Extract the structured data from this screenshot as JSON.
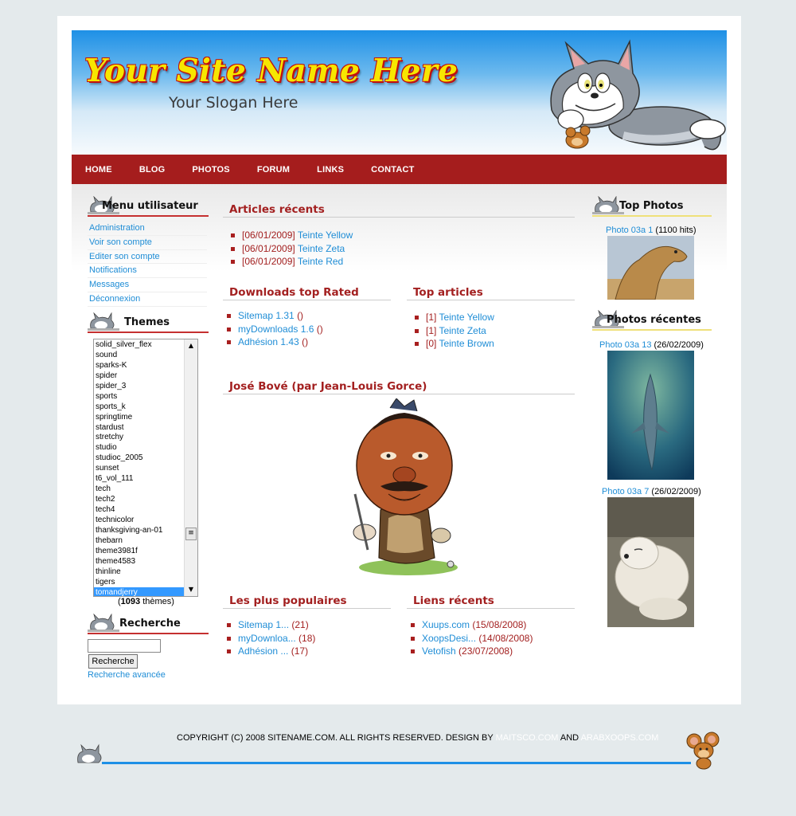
{
  "header": {
    "site_name": "Your Site Name Here",
    "slogan": "Your Slogan Here"
  },
  "nav": [
    "HOME",
    "BLOG",
    "PHOTOS",
    "FORUM",
    "LINKS",
    "CONTACT"
  ],
  "user_menu": {
    "title": "Menu utilisateur",
    "items": [
      "Administration",
      "Voir son compte",
      "Editer son compte",
      "Notifications",
      "Messages",
      "Déconnexion"
    ]
  },
  "themes": {
    "title": "Themes",
    "options": [
      "solid_silver_flex",
      "sound",
      "sparks-K",
      "spider",
      "spider_3",
      "sports",
      "sports_k",
      "springtime",
      "stardust",
      "stretchy",
      "studio",
      "studioc_2005",
      "sunset",
      "t6_vol_111",
      "tech",
      "tech2",
      "tech4",
      "technicolor",
      "thanksgiving-an-01",
      "thebarn",
      "theme3981f",
      "theme4583",
      "thinline",
      "tigers",
      "tomandjerry"
    ],
    "selected": "tomandjerry",
    "count": "1093",
    "count_suffix": "thèmes"
  },
  "search": {
    "title": "Recherche",
    "button": "Recherche",
    "advanced": "Recherche avancée",
    "value": ""
  },
  "recent_articles": {
    "title": "Articles récents",
    "items": [
      {
        "date": "[06/01/2009]",
        "link": "Teinte Yellow"
      },
      {
        "date": "[06/01/2009]",
        "link": "Teinte Zeta"
      },
      {
        "date": "[06/01/2009]",
        "link": "Teinte Red"
      }
    ]
  },
  "downloads_top": {
    "title": "Downloads top Rated",
    "items": [
      {
        "link": "Sitemap 1.31",
        "extra": "()"
      },
      {
        "link": "myDownloads 1.6",
        "extra": "()"
      },
      {
        "link": "Adhésion 1.43",
        "extra": "()"
      }
    ]
  },
  "top_articles": {
    "title": "Top articles",
    "items": [
      {
        "count": "[1]",
        "link": "Teinte Yellow"
      },
      {
        "count": "[1]",
        "link": "Teinte Zeta"
      },
      {
        "count": "[0]",
        "link": "Teinte Brown"
      }
    ]
  },
  "feature": {
    "title": "José Bové (par Jean-Louis Gorce)"
  },
  "popular": {
    "title": "Les plus populaires",
    "items": [
      {
        "link": "Sitemap 1...",
        "count": "(21)"
      },
      {
        "link": "myDownloa...",
        "count": "(18)"
      },
      {
        "link": "Adhésion ...",
        "count": "(17)"
      }
    ]
  },
  "recent_links": {
    "title": "Liens récents",
    "items": [
      {
        "link": "Xuups.com",
        "date": "(15/08/2008)"
      },
      {
        "link": "XoopsDesi...",
        "date": "(14/08/2008)"
      },
      {
        "link": "Vetofish",
        "date": "(23/07/2008)"
      }
    ]
  },
  "top_photos": {
    "title": "Top Photos",
    "items": [
      {
        "link": "Photo 03a 1",
        "info": "(1100 hits)"
      }
    ]
  },
  "recent_photos": {
    "title": "Photos récentes",
    "items": [
      {
        "link": "Photo 03a 13",
        "info": "(26/02/2009)"
      },
      {
        "link": "Photo 03a 7",
        "info": "(26/02/2009)"
      }
    ]
  },
  "footer": {
    "copyright": "COPYRIGHT (C) 2008 SITENAME.COM. ALL RIGHTS RESERVED. DESIGN BY",
    "link1": "MAITSCO.COM",
    "and": "AND",
    "link2": "ARABXOOPS.COM"
  },
  "colors": {
    "nav_bg": "#a51d1d",
    "link": "#1f8dd6",
    "heading": "#a32020",
    "header_blue": "#1e90e6"
  }
}
